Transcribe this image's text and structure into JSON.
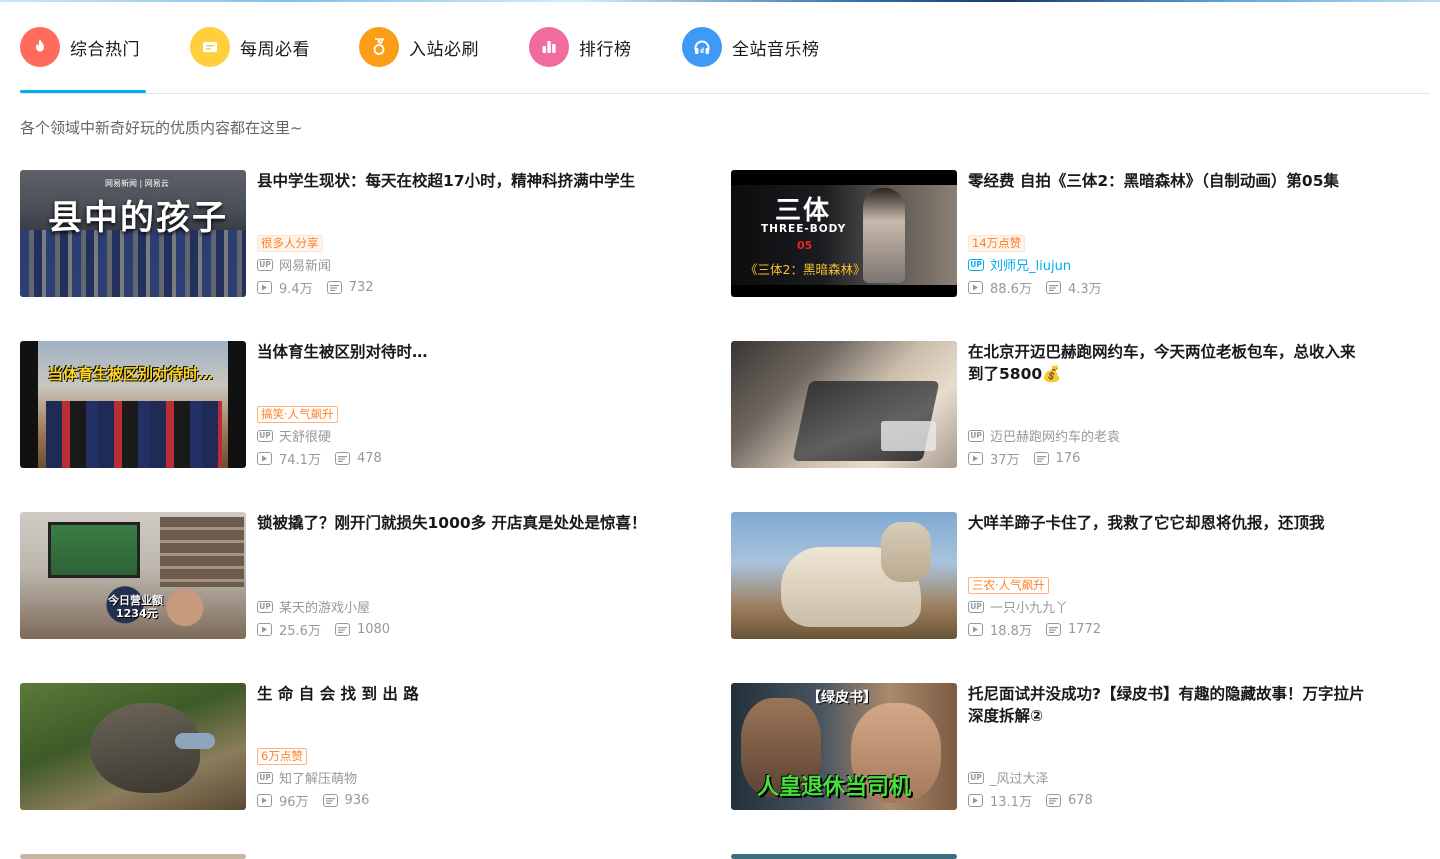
{
  "tabs": [
    {
      "label": "综合热门",
      "icon": "flame-icon",
      "color": "#ff6c5c"
    },
    {
      "label": "每周必看",
      "icon": "ticket-icon",
      "color": "#ffcf3d"
    },
    {
      "label": "入站必刷",
      "icon": "medal-icon",
      "color": "#fb9d17"
    },
    {
      "label": "排行榜",
      "icon": "bar-chart-icon",
      "color": "#f06b9e"
    },
    {
      "label": "全站音乐榜",
      "icon": "headphones-icon",
      "color": "#3f9af6"
    }
  ],
  "subtitle": "各个领域中新奇好玩的优质内容都在这里~",
  "videos": [
    {
      "title": "县中学生现状：每天在校超17小时，精神科挤满中学生",
      "badge": "很多人分享",
      "author": "网易新闻",
      "views": "9.4万",
      "danmaku": "732",
      "thumb_text": "县中的孩子",
      "thumb_brand": "网易新闻 | 网易云"
    },
    {
      "title": "零经费 自拍《三体2：黑暗森林》（自制动画）第05集",
      "badge": "14万点赞",
      "author": "刘师兄_liujun",
      "views": "88.6万",
      "danmaku": "4.3万",
      "thumb_text": "三体",
      "thumb_sub": "THREE-BODY",
      "thumb_ep": "05",
      "thumb_caption": "《三体2：黑暗森林》"
    },
    {
      "title": "当体育生被区别对待时…",
      "badge": "搞笑·人气飙升",
      "author": "天舒很硬",
      "views": "74.1万",
      "danmaku": "478",
      "thumb_text": "当体育生被区别对待时…"
    },
    {
      "title": "在北京开迈巴赫跑网约车，今天两位老板包车，总收入来到了5800💰",
      "badge": "",
      "author": "迈巴赫跑网约车的老袁",
      "views": "37万",
      "danmaku": "176"
    },
    {
      "title": "锁被撬了？刚开门就损失1000多 开店真是处处是惊喜！",
      "badge": "",
      "author": "某天的游戏小屋",
      "views": "25.6万",
      "danmaku": "1080",
      "thumb_text": "今日营业额",
      "thumb_text2": "1234元"
    },
    {
      "title": "大咩羊蹄子卡住了，我救了它它却恩将仇报，还顶我",
      "badge": "三农·人气飙升",
      "author": "一只小九九丫",
      "views": "18.8万",
      "danmaku": "1772"
    },
    {
      "title": "生 命 自 会 找 到 出 路",
      "badge": "6万点赞",
      "author": "知了解压萌物",
      "views": "96万",
      "danmaku": "936"
    },
    {
      "title": "托尼面试并没成功?【绿皮书】有趣的隐藏故事！万字拉片深度拆解②",
      "badge": "",
      "author": "_风过大泽",
      "views": "13.1万",
      "danmaku": "678",
      "thumb_text": "【绿皮书】",
      "thumb_text2": "人皇退休当司机"
    }
  ],
  "up_label": "UP",
  "colors": {
    "accent": "#00aeec",
    "badge": "#ff7f24",
    "meta": "#9499a0"
  }
}
